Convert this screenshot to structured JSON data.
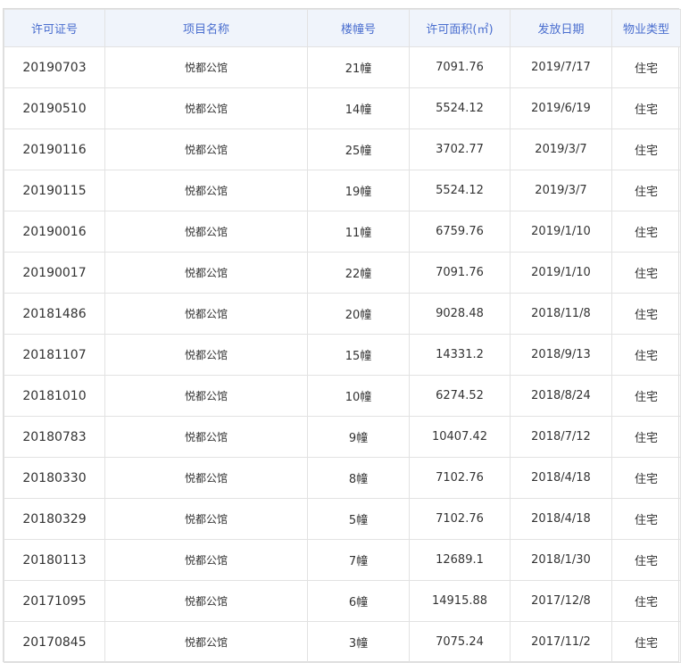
{
  "table": {
    "headers": [
      "许可证号",
      "项目名称",
      "楼幢号",
      "许可面积(㎡)",
      "发放日期",
      "物业类型"
    ],
    "rows": [
      [
        "20190703",
        "悦都公馆",
        "21幢",
        "7091.76",
        "2019/7/17",
        "住宅"
      ],
      [
        "20190510",
        "悦都公馆",
        "14幢",
        "5524.12",
        "2019/6/19",
        "住宅"
      ],
      [
        "20190116",
        "悦都公馆",
        "25幢",
        "3702.77",
        "2019/3/7",
        "住宅"
      ],
      [
        "20190115",
        "悦都公馆",
        "19幢",
        "5524.12",
        "2019/3/7",
        "住宅"
      ],
      [
        "20190016",
        "悦都公馆",
        "11幢",
        "6759.76",
        "2019/1/10",
        "住宅"
      ],
      [
        "20190017",
        "悦都公馆",
        "22幢",
        "7091.76",
        "2019/1/10",
        "住宅"
      ],
      [
        "20181486",
        "悦都公馆",
        "20幢",
        "9028.48",
        "2018/11/8",
        "住宅"
      ],
      [
        "20181107",
        "悦都公馆",
        "15幢",
        "14331.2",
        "2018/9/13",
        "住宅"
      ],
      [
        "20181010",
        "悦都公馆",
        "10幢",
        "6274.52",
        "2018/8/24",
        "住宅"
      ],
      [
        "20180783",
        "悦都公馆",
        "9幢",
        "10407.42",
        "2018/7/12",
        "住宅"
      ],
      [
        "20180330",
        "悦都公馆",
        "8幢",
        "7102.76",
        "2018/4/18",
        "住宅"
      ],
      [
        "20180329",
        "悦都公馆",
        "5幢",
        "7102.76",
        "2018/4/18",
        "住宅"
      ],
      [
        "20180113",
        "悦都公馆",
        "7幢",
        "12689.1",
        "2018/1/30",
        "住宅"
      ],
      [
        "20171095",
        "悦都公馆",
        "6幢",
        "14915.88",
        "2017/12/8",
        "住宅"
      ],
      [
        "20170845",
        "悦都公馆",
        "3幢",
        "7075.24",
        "2017/11/2",
        "住宅"
      ]
    ]
  },
  "colors": {
    "header_text": "#4a6ecf",
    "header_bg": "#f0f4fb",
    "cell_text": "#333333",
    "border": "#e2e2e2"
  }
}
